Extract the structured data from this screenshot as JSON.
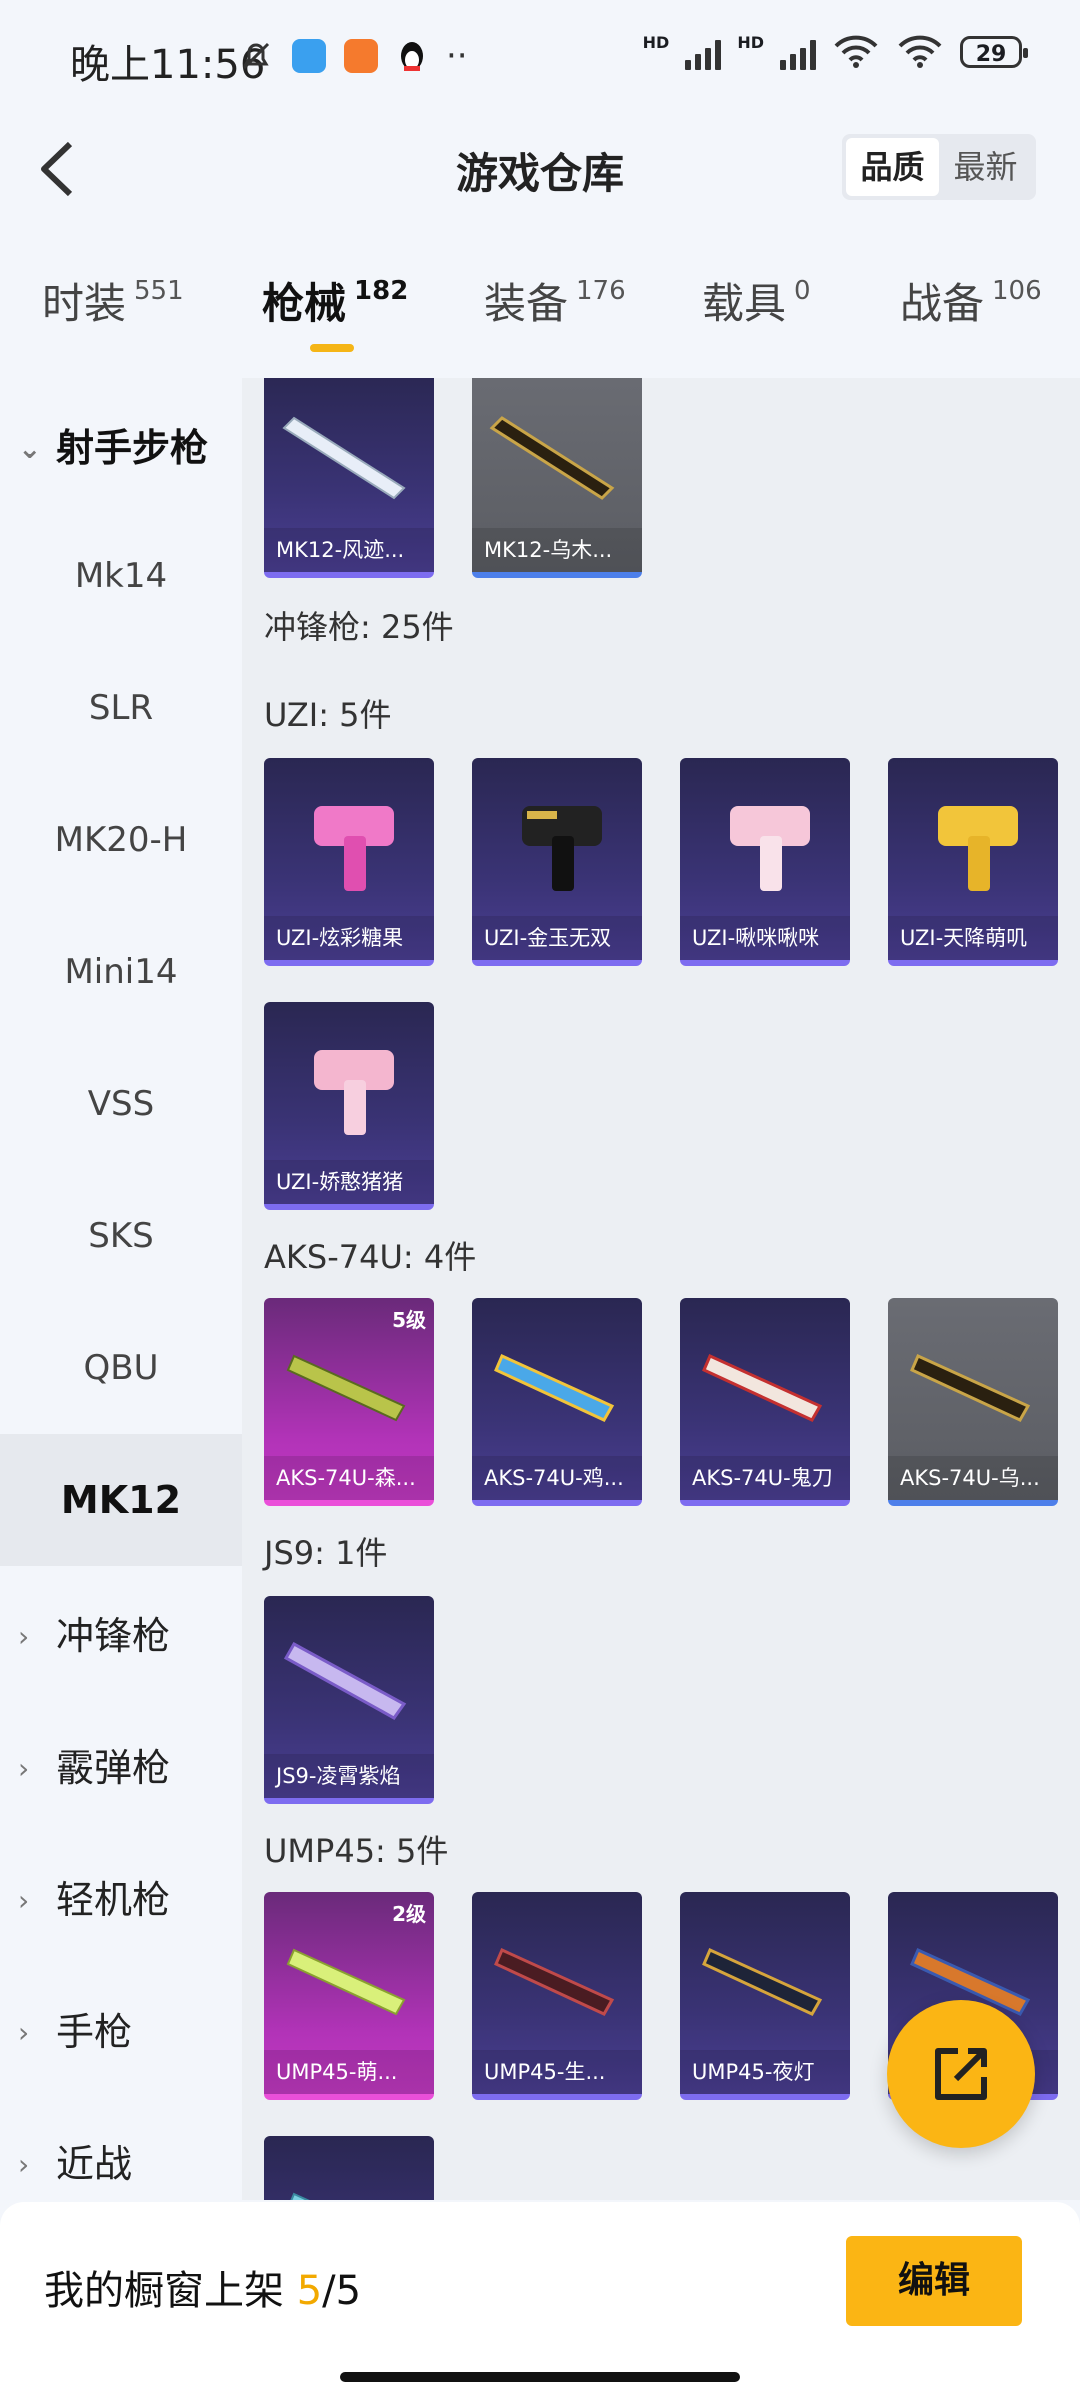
{
  "status_bar": {
    "time": "晚上11:56",
    "hd1": "HD",
    "hd2": "HD",
    "battery": "29"
  },
  "header": {
    "title": "游戏仓库",
    "sort_options": [
      "品质",
      "最新"
    ],
    "sort_selected": "品质"
  },
  "tabs": [
    {
      "label": "时装",
      "count": "551"
    },
    {
      "label": "枪械",
      "count": "182"
    },
    {
      "label": "装备",
      "count": "176"
    },
    {
      "label": "载具",
      "count": "0"
    },
    {
      "label": "战备",
      "count": "106"
    }
  ],
  "sidebar": {
    "expanded_group": "射手步枪",
    "items": [
      "Mk14",
      "SLR",
      "MK20-H",
      "Mini14",
      "VSS",
      "SKS",
      "QBU",
      "MK12"
    ],
    "selected": "MK12",
    "groups": [
      "冲锋枪",
      "霰弹枪",
      "轻机枪",
      "手枪",
      "近战"
    ]
  },
  "content": {
    "top_cards": [
      {
        "name": "MK12-风迹...",
        "rarity": "purple"
      },
      {
        "name": "MK12-乌木...",
        "rarity": "gray"
      }
    ],
    "category_title": "冲锋枪: 25件",
    "sections": [
      {
        "title": "UZI: 5件",
        "cards": [
          {
            "name": "UZI-炫彩糖果",
            "rarity": "purple"
          },
          {
            "name": "UZI-金玉无双",
            "rarity": "purple"
          },
          {
            "name": "UZI-啾咪啾咪",
            "rarity": "purple"
          },
          {
            "name": "UZI-天降萌叽",
            "rarity": "purple"
          },
          {
            "name": "UZI-娇憨猪猪",
            "rarity": "purple"
          }
        ]
      },
      {
        "title": "AKS-74U: 4件",
        "cards": [
          {
            "name": "AKS-74U-森...",
            "rarity": "pink",
            "level": "5级"
          },
          {
            "name": "AKS-74U-鸡...",
            "rarity": "purple"
          },
          {
            "name": "AKS-74U-鬼刀",
            "rarity": "purple"
          },
          {
            "name": "AKS-74U-乌...",
            "rarity": "gray"
          }
        ]
      },
      {
        "title": "JS9: 1件",
        "cards": [
          {
            "name": "JS9-凌霄紫焰",
            "rarity": "purple"
          }
        ]
      },
      {
        "title": "UMP45: 5件",
        "cards": [
          {
            "name": "UMP45-萌...",
            "rarity": "pink",
            "level": "2级"
          },
          {
            "name": "UMP45-生...",
            "rarity": "purple"
          },
          {
            "name": "UMP45-夜灯",
            "rarity": "purple"
          },
          {
            "name": "",
            "rarity": "purple"
          }
        ]
      }
    ]
  },
  "bottom": {
    "label": "我的橱窗上架",
    "count": "5",
    "total": "/5",
    "edit_label": "编辑"
  },
  "colors": {
    "accent": "#fbb514",
    "purple_border": "#7d6cf0",
    "pink_border": "#ea4fd9",
    "gray_border": "#4d7fea"
  }
}
